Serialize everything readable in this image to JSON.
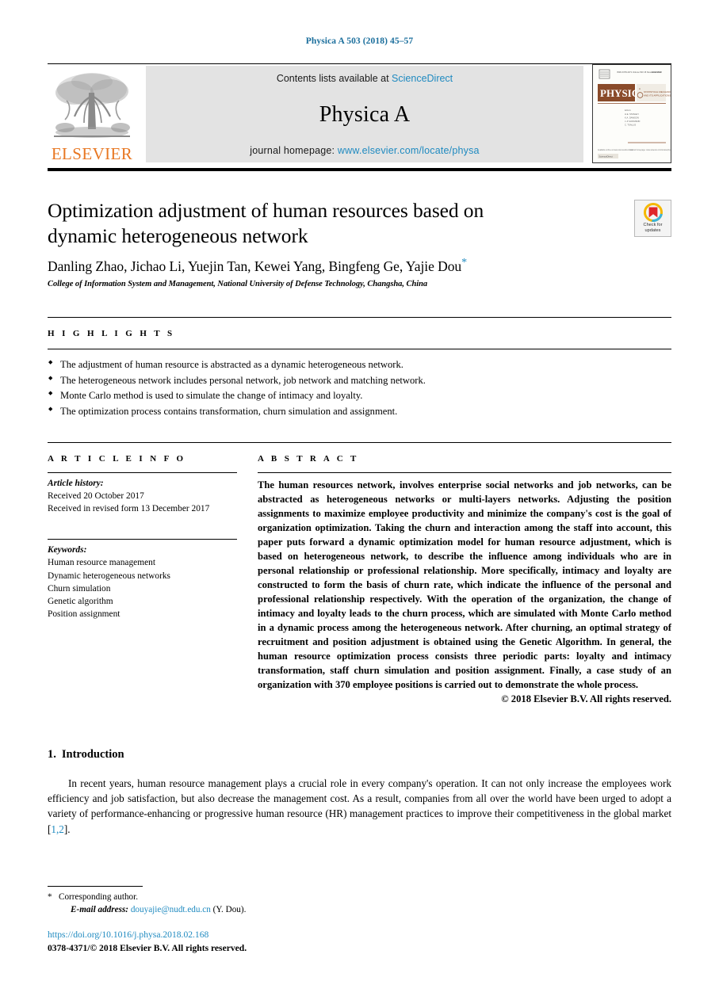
{
  "running_head": "Physica A 503 (2018) 45–57",
  "masthead": {
    "publisher_name": "ELSEVIER",
    "contents_prefix": "Contents lists available at",
    "contents_link": "ScienceDirect",
    "journal_title": "Physica A",
    "homepage_prefix": "journal homepage:",
    "homepage_url": "www.elsevier.com/locate/physa",
    "cover_word": "PHYSICA",
    "cover_subtitle": "STATISTICAL MECHANICS AND ITS APPLICATIONS"
  },
  "article": {
    "title": "Optimization adjustment of human resources based on dynamic heterogeneous network",
    "authors": "Danling Zhao, Jichao Li, Yuejin Tan, Kewei Yang, Bingfeng Ge, Yajie Dou",
    "corresponding_marker": "*",
    "affiliation": "College of Information System and Management, National University of Defense Technology, Changsha, China",
    "crossmark_line1": "Check for",
    "crossmark_line2": "updates"
  },
  "highlights": {
    "heading": "H I G H L I G H T S",
    "items": [
      "The adjustment of human resource is abstracted as a dynamic heterogeneous network.",
      "The heterogeneous network includes personal network, job network and matching network.",
      "Monte Carlo method is used to simulate the change of intimacy and loyalty.",
      "The optimization process contains transformation, churn simulation and assignment."
    ]
  },
  "article_info": {
    "heading": "A R T I C L E  I N F O",
    "history_label": "Article history:",
    "history": [
      "Received 20 October 2017",
      "Received in revised form 13 December 2017"
    ],
    "keywords_label": "Keywords:",
    "keywords": [
      "Human resource management",
      "Dynamic heterogeneous networks",
      "Churn simulation",
      "Genetic algorithm",
      "Position assignment"
    ]
  },
  "abstract": {
    "heading": "A B S T R A C T",
    "text": "The human resources network, involves enterprise social networks and job networks, can be abstracted as heterogeneous networks or multi-layers networks. Adjusting the position assignments to maximize employee productivity and minimize the company's cost is the goal of organization optimization. Taking the churn and interaction among the staff into account, this paper puts forward a dynamic optimization model for human resource adjustment, which is based on heterogeneous network, to describe the influence among individuals who are in personal relationship or professional relationship. More specifically, intimacy and loyalty are constructed to form the basis of churn rate, which indicate the influence of the personal and professional relationship respectively. With the operation of the organization, the change of intimacy and loyalty leads to the churn process, which are simulated with Monte Carlo method in a dynamic process among the heterogeneous network. After churning, an optimal strategy of recruitment and position adjustment is obtained using the Genetic Algorithm. In general, the human resource optimization process consists three periodic parts: loyalty and intimacy transformation, staff churn simulation and position assignment. Finally, a case study of an organization with 370 employee positions is carried out to demonstrate the whole process.",
    "copyright": "© 2018 Elsevier B.V. All rights reserved."
  },
  "introduction": {
    "number": "1.",
    "title": "Introduction",
    "paragraph_part1": "In recent years, human resource management plays a crucial role in every company's operation. It can not only increase the employees work efficiency and job satisfaction, but also decrease the management cost. As a result, companies from all over the world have been urged to adopt a variety of performance-enhancing or progressive human resource (HR) management practices to improve their competitiveness in the global market [",
    "citation": "1,2",
    "paragraph_part2": "]."
  },
  "footnote": {
    "star": "*",
    "corresponding": "Corresponding author.",
    "email_label": "E-mail address:",
    "email": "douyajie@nudt.edu.cn",
    "email_suffix": "(Y. Dou)."
  },
  "imprint": {
    "doi": "https://doi.org/10.1016/j.physa.2018.02.168",
    "issn_line": "0378-4371/© 2018 Elsevier B.V. All rights reserved."
  },
  "colors": {
    "link_blue": "#1f8ac0",
    "elsevier_orange": "#E87722",
    "cover_brown": "#8a4b2a",
    "crossmark_yellow": "#F5B800",
    "crossmark_red": "#E0262B",
    "band_gray": "#e3e3e3"
  }
}
